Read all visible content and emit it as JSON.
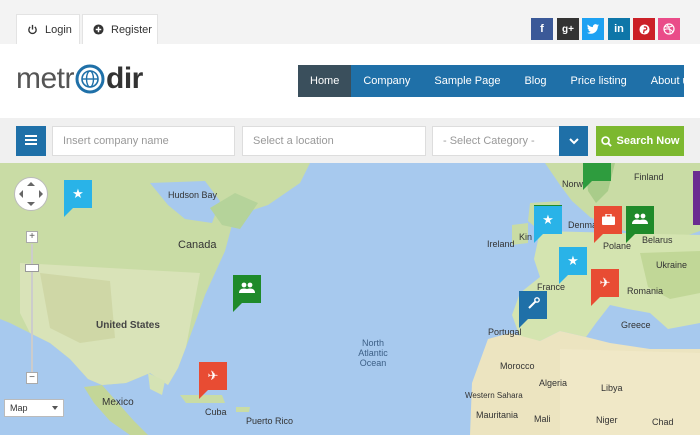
{
  "auth": {
    "login_label": "Login",
    "register_label": "Register"
  },
  "social": [
    {
      "icon": "facebook-icon",
      "glyph": "f",
      "color": "#3b5998"
    },
    {
      "icon": "google-plus-icon",
      "glyph": "g+",
      "color": "#333333"
    },
    {
      "icon": "twitter-icon",
      "glyph": "t",
      "color": "#1da1f2"
    },
    {
      "icon": "linkedin-icon",
      "glyph": "in",
      "color": "#0e76a8"
    },
    {
      "icon": "pinterest-icon",
      "glyph": "p",
      "color": "#cb2027"
    },
    {
      "icon": "dribbble-icon",
      "glyph": "◎",
      "color": "#ea4c89"
    }
  ],
  "logo": {
    "part1": "metr",
    "part2": "dir"
  },
  "nav": [
    "Home",
    "Company",
    "Sample Page",
    "Blog",
    "Price listing",
    "About us"
  ],
  "search": {
    "company_placeholder": "Insert company name",
    "location_placeholder": "Select a location",
    "category_value": "- Select Category -",
    "button_label": "Search Now"
  },
  "map": {
    "type_label": "Map",
    "labels": {
      "hudson_bay": "Hudson Bay",
      "canada": "Canada",
      "united_states": "United States",
      "mexico": "Mexico",
      "cuba": "Cuba",
      "puerto_rico": "Puerto Rico",
      "ocean_1": "North",
      "ocean_2": "Atlantic",
      "ocean_3": "Ocean",
      "norway": "Norw",
      "finland": "Finland",
      "ireland": "Ireland",
      "denmark": "Denmark",
      "poland": "Polane",
      "belarus": "Belarus",
      "ukraine": "Ukraine",
      "france": "France",
      "romania": "Romania",
      "portugal": "Portugal",
      "greece": "Greece",
      "morocco": "Morocco",
      "algeria": "Algeria",
      "libya": "Libya",
      "western_sahara": "Western Sahara",
      "mali": "Mali",
      "niger": "Niger",
      "chad": "Chad",
      "mauritania": "Mauritania",
      "kingdom": "Kin"
    },
    "pin_colors": {
      "blue": "#29b3e8",
      "green": "#1f8a2a",
      "red": "#e84c33",
      "navy": "#1f70a8"
    }
  }
}
